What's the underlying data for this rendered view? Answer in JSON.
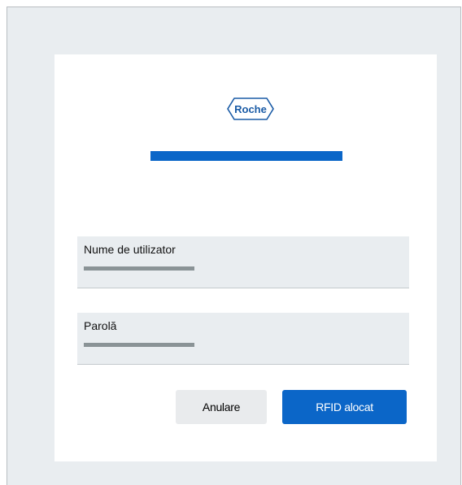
{
  "logo": {
    "text": "Roche",
    "color": "#1a5ba6"
  },
  "progress": {
    "color": "#0b66c8"
  },
  "username": {
    "label": "Nume de utilizator"
  },
  "password": {
    "label": "Parolă"
  },
  "buttons": {
    "cancel_label": "Anulare",
    "rfid_label": "RFID alocat"
  },
  "colors": {
    "accent": "#0b66c8",
    "background": "#e9edf0"
  }
}
